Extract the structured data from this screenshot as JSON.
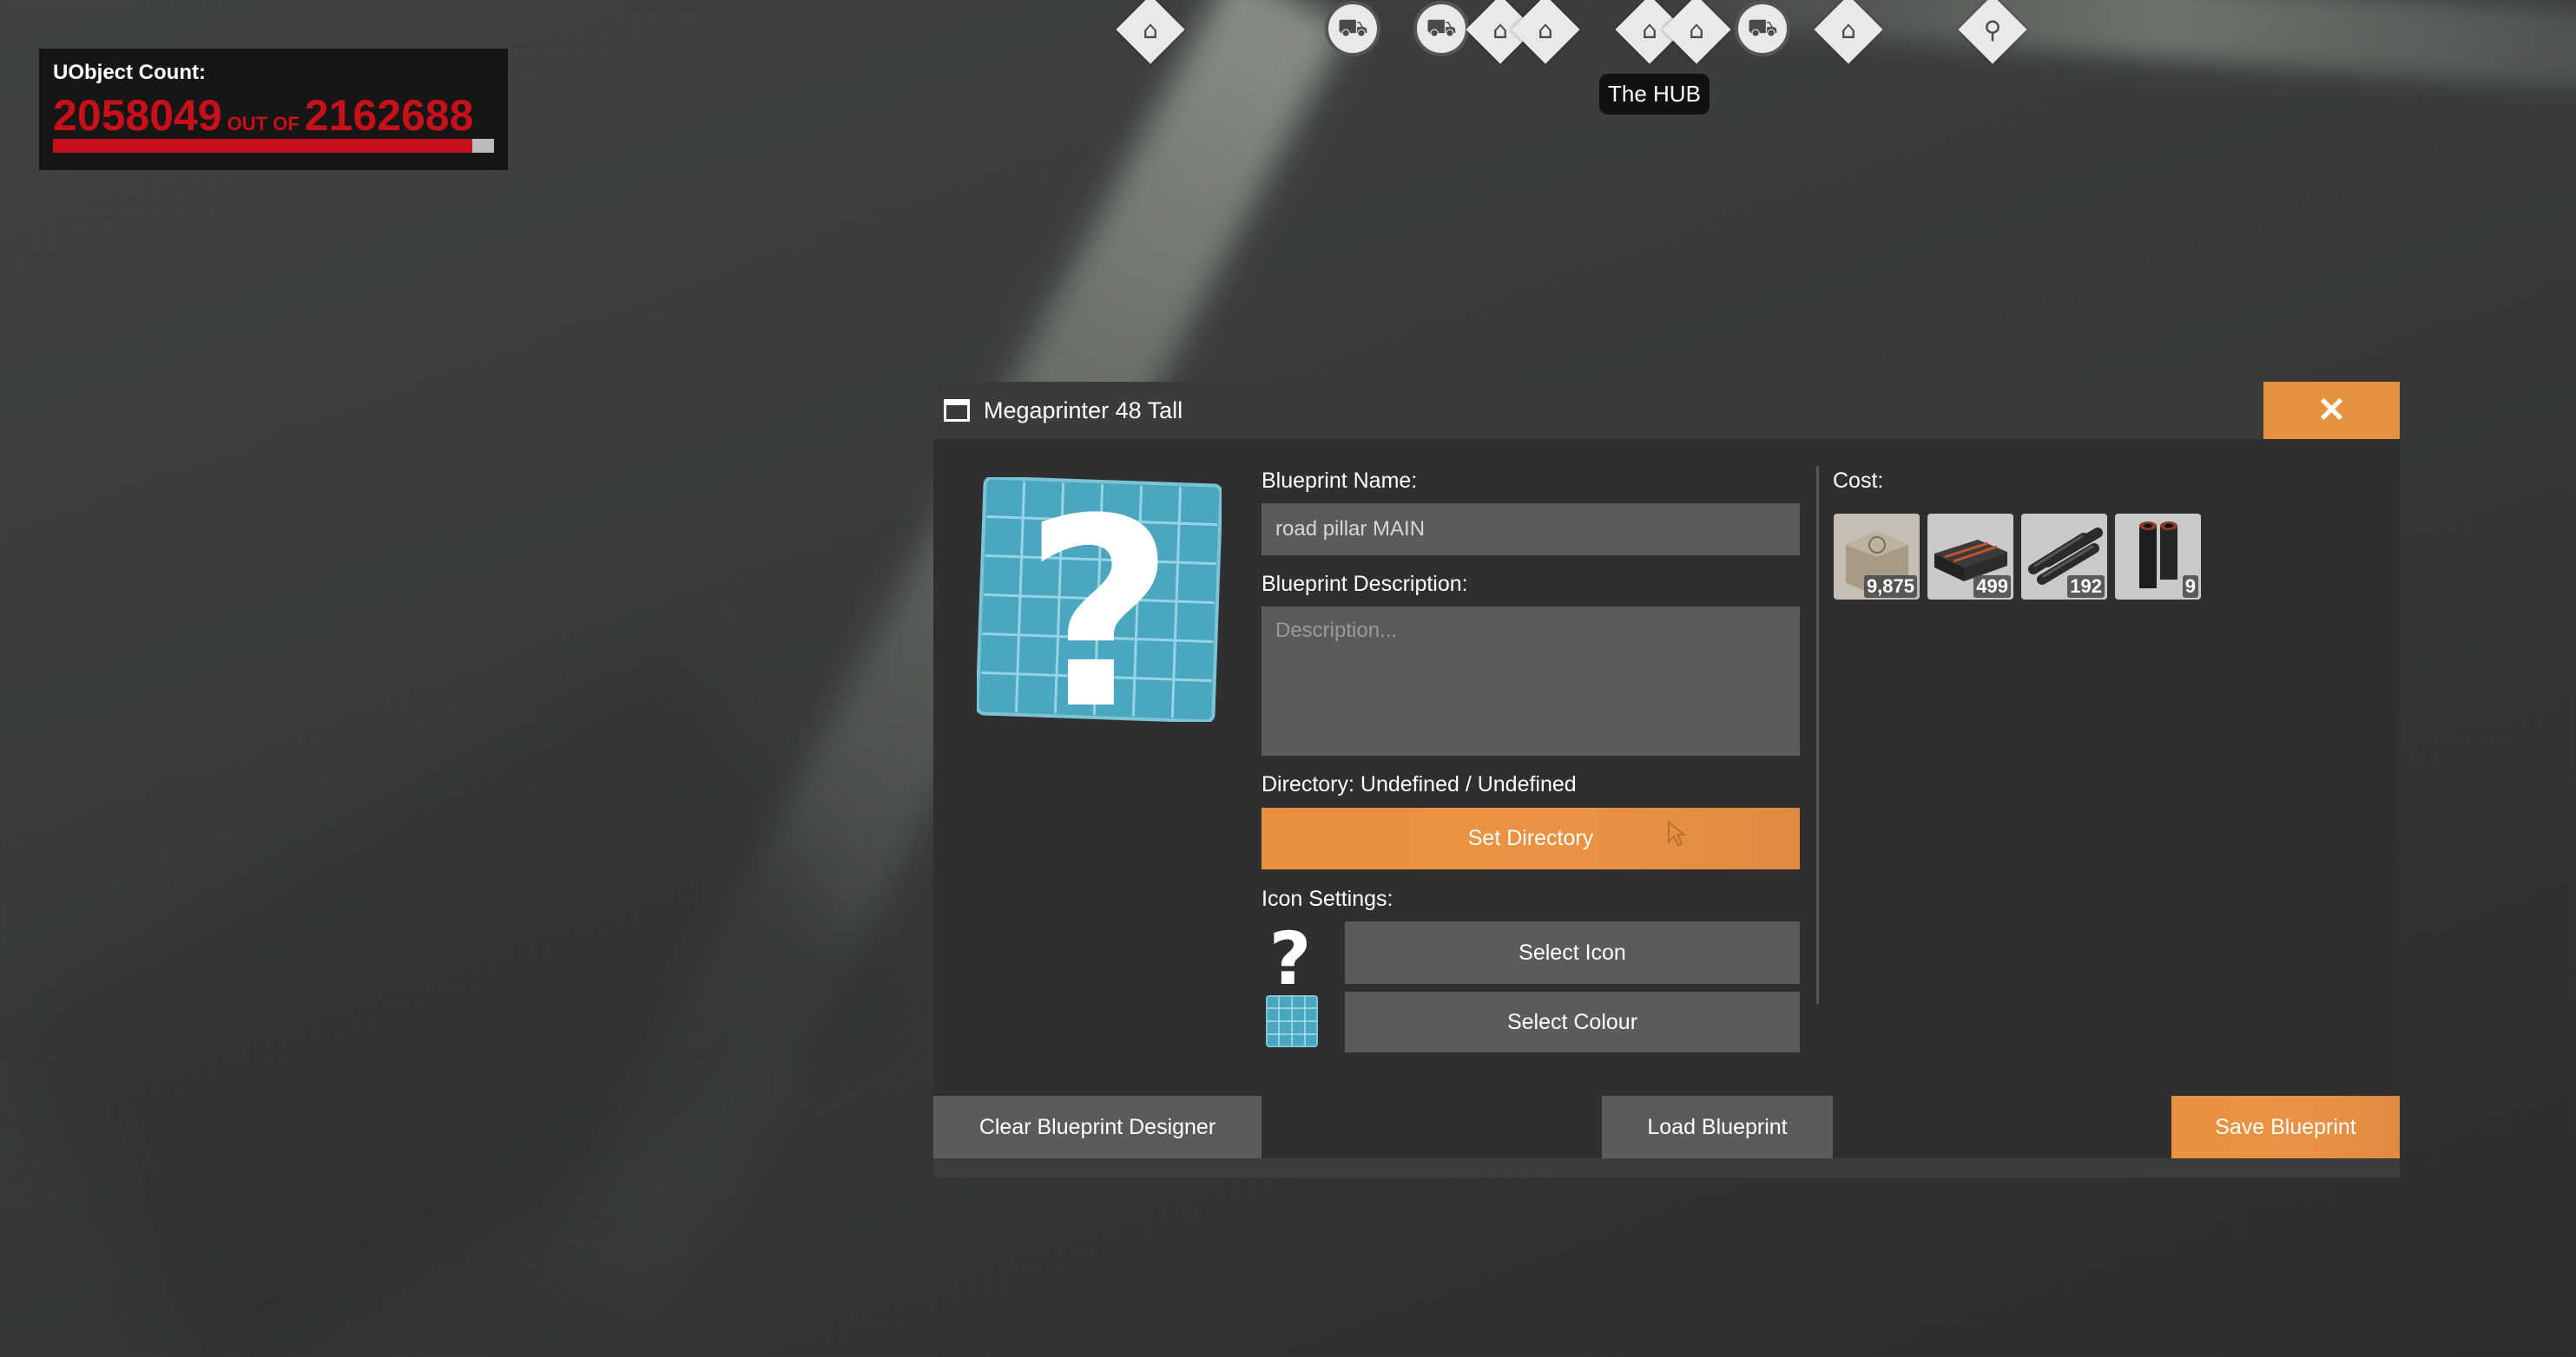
{
  "hud": {
    "uobject_label": "UObject Count:",
    "current_count": "2058049",
    "out_of_label": "OUT OF",
    "max_count": "2162688",
    "fill_fraction": 0.9516,
    "count_color": "#c8101a"
  },
  "compass": {
    "tooltip": "The HUB",
    "markers": [
      "factory-icon",
      "tractor-icon",
      "truck-icon",
      "factory-icon",
      "hub-icon",
      "factory-icon",
      "tractor-icon",
      "factory-icon",
      "tower-icon"
    ]
  },
  "window": {
    "title": "Megaprinter 48 Tall",
    "close_label": "✕",
    "accent_color": "#e5933f",
    "blueprint_name_label": "Blueprint Name:",
    "blueprint_name_value": "road pillar MAIN",
    "blueprint_description_label": "Blueprint Description:",
    "blueprint_description_placeholder": "Description...",
    "directory_label": "Directory: Undefined / Undefined",
    "set_directory_label": "Set Directory",
    "icon_settings_label": "Icon Settings:",
    "select_icon_label": "Select Icon",
    "select_colour_label": "Select Colour",
    "cost_label": "Cost:",
    "cost_items": [
      {
        "item": "concrete",
        "qty": "9,875"
      },
      {
        "item": "steel-beam",
        "qty": "499"
      },
      {
        "item": "steel-pipe",
        "qty": "192"
      },
      {
        "item": "encased-beam",
        "qty": "9"
      }
    ],
    "clear_label": "Clear Blueprint Designer",
    "load_label": "Load Blueprint",
    "save_label": "Save Blueprint"
  }
}
